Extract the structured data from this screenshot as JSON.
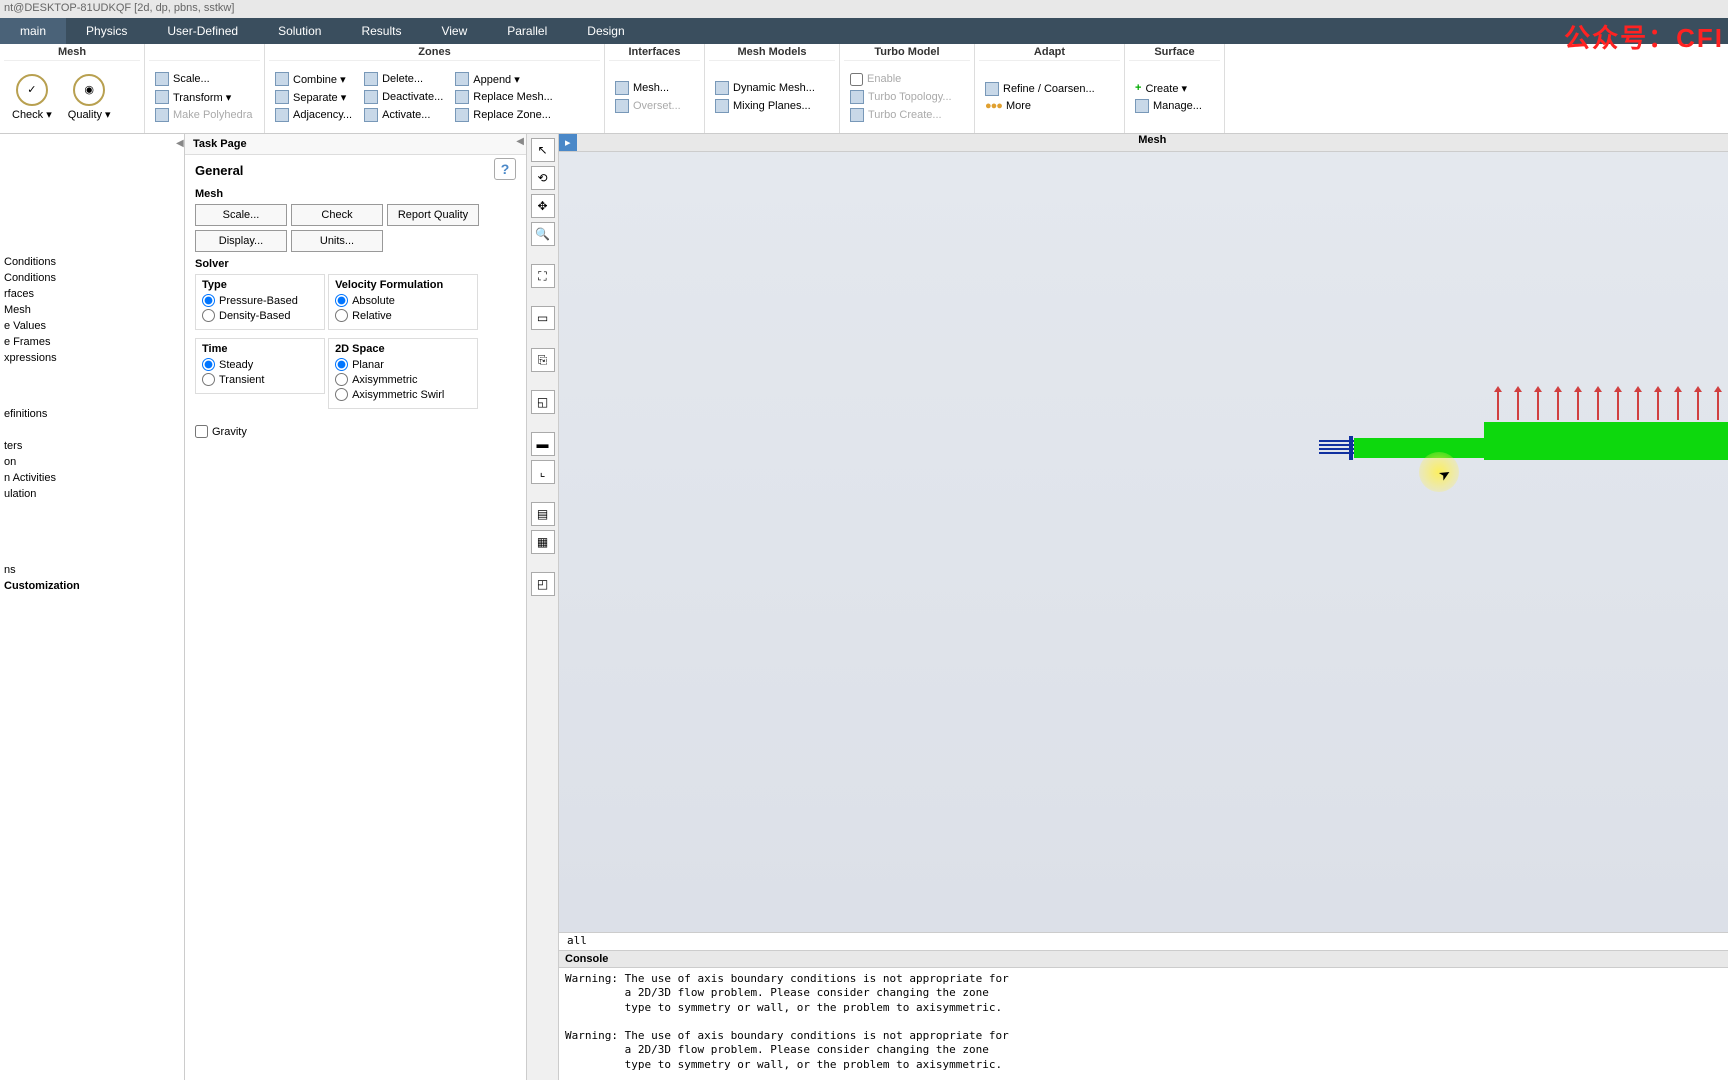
{
  "titlebar": "nt@DESKTOP-81UDKQF [2d, dp, pbns, sstkw]",
  "watermark": "公众号：CFI",
  "menu": {
    "tabs": [
      "main",
      "Physics",
      "User-Defined",
      "Solution",
      "Results",
      "View",
      "Parallel",
      "Design"
    ],
    "active_index": 0
  },
  "ribbon": {
    "mesh": {
      "title": "Mesh",
      "check": "Check ▾",
      "quality": "Quality ▾",
      "scale": "Scale...",
      "transform": "Transform ▾",
      "polyhedra": "Make Polyhedra"
    },
    "zones": {
      "title": "Zones",
      "combine": "Combine ▾",
      "separate": "Separate ▾",
      "adjacency": "Adjacency...",
      "delete": "Delete...",
      "deactivate": "Deactivate...",
      "activate": "Activate...",
      "append": "Append ▾",
      "replace_mesh": "Replace Mesh...",
      "replace_zone": "Replace Zone..."
    },
    "interfaces": {
      "title": "Interfaces",
      "mesh": "Mesh...",
      "overset": "Overset..."
    },
    "mesh_models": {
      "title": "Mesh Models",
      "dynamic": "Dynamic Mesh...",
      "mixing": "Mixing Planes..."
    },
    "turbo": {
      "title": "Turbo Model",
      "enable": "Enable",
      "topology": "Turbo Topology...",
      "create": "Turbo Create..."
    },
    "adapt": {
      "title": "Adapt",
      "refine": "Refine / Coarsen...",
      "more": "More"
    },
    "surface": {
      "title": "Surface",
      "create": "Create ▾",
      "manage": "Manage..."
    }
  },
  "outline": {
    "items": [
      " Conditions",
      " Conditions",
      "rfaces",
      " Mesh",
      "e Values",
      "e Frames",
      "xpressions",
      "",
      "efinitions",
      "",
      "ters",
      "on",
      "n Activities",
      "ulation",
      "",
      "ns",
      "Customization"
    ]
  },
  "taskpage": {
    "header": "Task Page",
    "title": "General",
    "mesh": {
      "label": "Mesh",
      "scale": "Scale...",
      "check": "Check",
      "report": "Report Quality",
      "display": "Display...",
      "units": "Units..."
    },
    "solver": {
      "label": "Solver",
      "type": {
        "label": "Type",
        "opts": [
          "Pressure-Based",
          "Density-Based"
        ],
        "sel": 0
      },
      "velocity": {
        "label": "Velocity Formulation",
        "opts": [
          "Absolute",
          "Relative"
        ],
        "sel": 0
      },
      "time": {
        "label": "Time",
        "opts": [
          "Steady",
          "Transient"
        ],
        "sel": 0
      },
      "space": {
        "label": "2D Space",
        "opts": [
          "Planar",
          "Axisymmetric",
          "Axisymmetric Swirl"
        ],
        "sel": 0
      }
    },
    "gravity": "Gravity"
  },
  "viewport": {
    "tab_icon": "▸",
    "title": "Mesh"
  },
  "zonebar": "all",
  "console": {
    "title": "Console",
    "text": "Warning: The use of axis boundary conditions is not appropriate for\n         a 2D/3D flow problem. Please consider changing the zone\n         type to symmetry or wall, or the problem to axisymmetric.\n\nWarning: The use of axis boundary conditions is not appropriate for\n         a 2D/3D flow problem. Please consider changing the zone\n         type to symmetry or wall, or the problem to axisymmetric."
  }
}
